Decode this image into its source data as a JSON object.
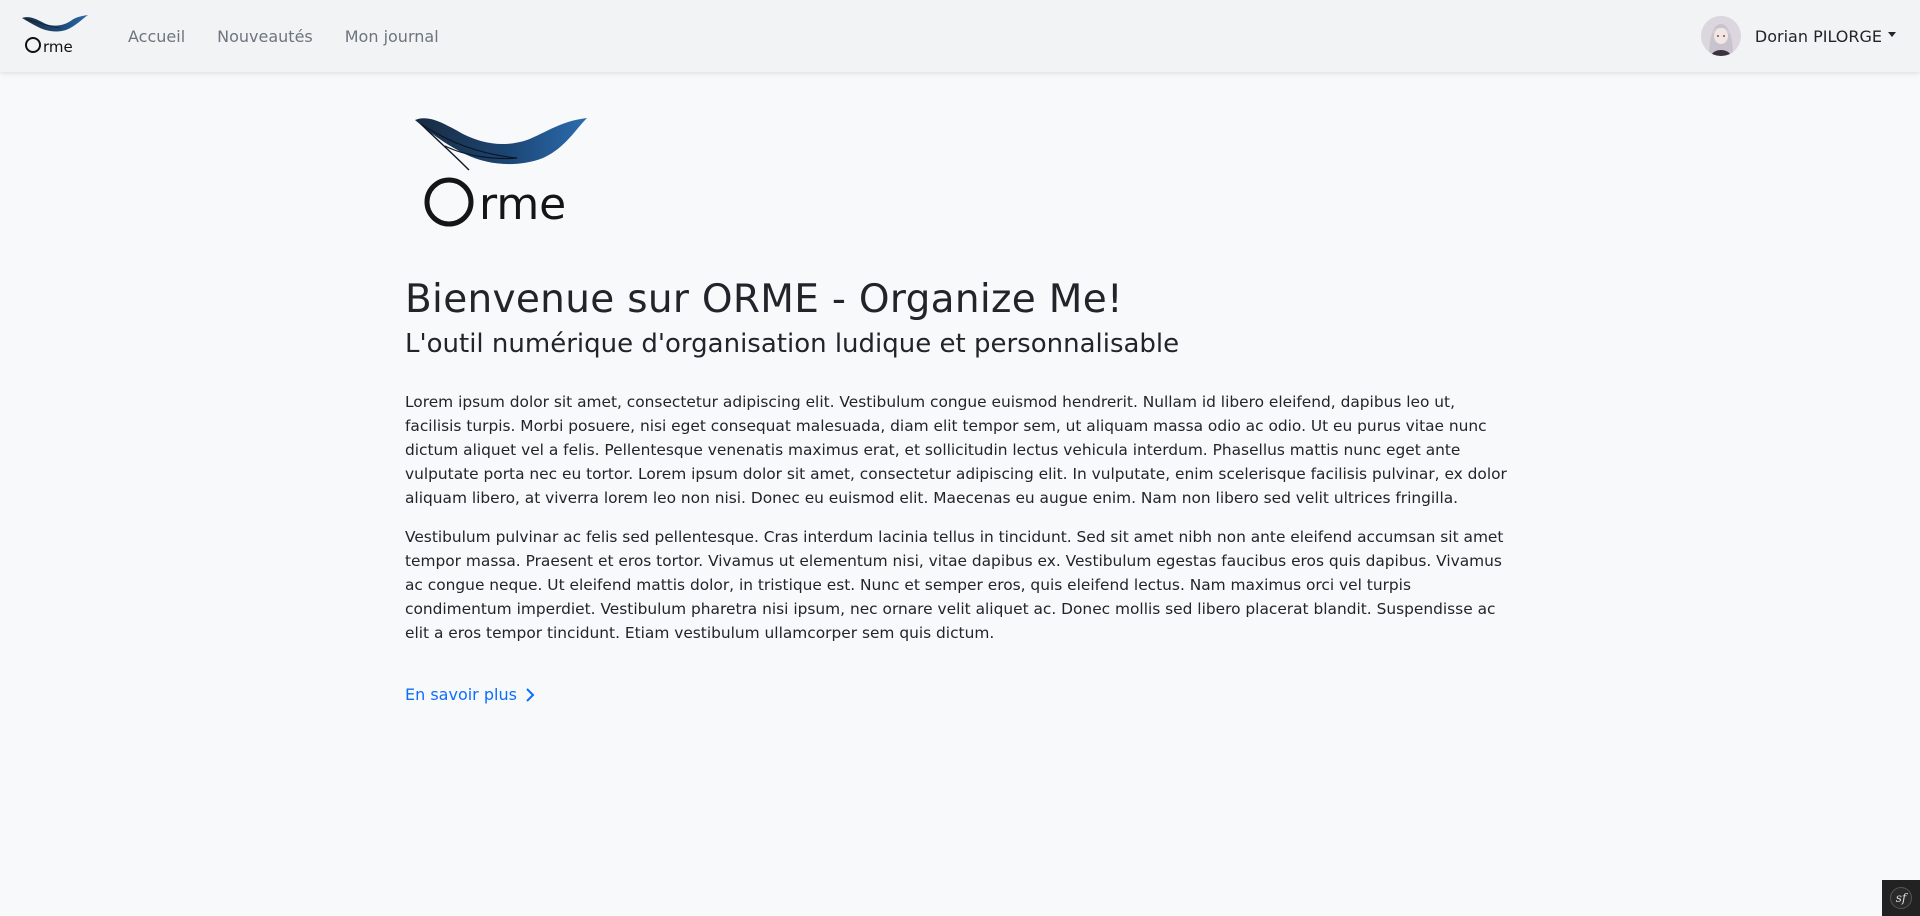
{
  "brand": {
    "logo_text": "Orme",
    "color_feather": "#1e4a7a"
  },
  "nav": {
    "items": [
      {
        "label": "Accueil"
      },
      {
        "label": "Nouveautés"
      },
      {
        "label": "Mon journal"
      }
    ]
  },
  "user": {
    "name": "Dorian PILORGE"
  },
  "main": {
    "title": "Bienvenue sur ORME - Organize Me!",
    "subtitle": "L'outil numérique d'organisation ludique et personnalisable",
    "paragraphs": [
      "Lorem ipsum dolor sit amet, consectetur adipiscing elit. Vestibulum congue euismod hendrerit. Nullam id libero eleifend, dapibus leo ut, facilisis turpis. Morbi posuere, nisi eget consequat malesuada, diam elit tempor sem, ut aliquam massa odio ac odio. Ut eu purus vitae nunc dictum aliquet vel a felis. Pellentesque venenatis maximus erat, et sollicitudin lectus vehicula interdum. Phasellus mattis nunc eget ante vulputate porta nec eu tortor. Lorem ipsum dolor sit amet, consectetur adipiscing elit. In vulputate, enim scelerisque facilisis pulvinar, ex dolor aliquam libero, at viverra lorem leo non nisi. Donec eu euismod elit. Maecenas eu augue enim. Nam non libero sed velit ultrices fringilla.",
      "Vestibulum pulvinar ac felis sed pellentesque. Cras interdum lacinia tellus in tincidunt. Sed sit amet nibh non ante eleifend accumsan sit amet tempor massa. Praesent et eros tortor. Vivamus ut elementum nisi, vitae dapibus ex. Vestibulum egestas faucibus eros quis dapibus. Vivamus ac congue neque. Ut eleifend mattis dolor, in tristique est. Nunc et semper eros, quis eleifend lectus. Nam maximus orci vel turpis condimentum imperdiet. Vestibulum pharetra nisi ipsum, nec ornare velit aliquet ac. Donec mollis sed libero placerat blandit. Suspendisse ac elit a eros tempor tincidunt. Etiam vestibulum ullamcorper sem quis dictum."
    ],
    "more_link": "En savoir plus"
  },
  "colors": {
    "link": "#0d6efd",
    "nav_text": "#6c757d"
  },
  "icons": {
    "caret": "caret-down-icon",
    "chevron": "chevron-right-icon",
    "profiler": "symfony-icon"
  }
}
